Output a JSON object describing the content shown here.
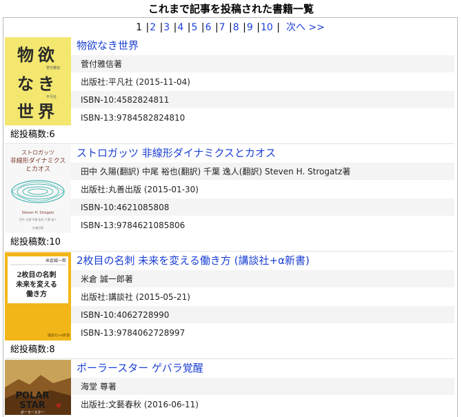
{
  "page": {
    "title": "これまで記事を投稿された書籍一覧"
  },
  "pagination": {
    "current": "1",
    "pages": [
      "2",
      "3",
      "4",
      "5",
      "6",
      "7",
      "8",
      "9",
      "10"
    ],
    "separator": "|",
    "next_label": "次へ >>"
  },
  "books": [
    {
      "title": "物欲なき世界",
      "author": "菅付雅信著",
      "publisher": "出版社:平凡社 (2015-11-04)",
      "isbn10": "ISBN-10:4582824811",
      "isbn13": "ISBN-13:9784582824810",
      "total": "総投稿数:6",
      "cover": {
        "lines": [
          "物 欲",
          "な き",
          "世 界"
        ],
        "bg": "#f3e770",
        "subtext": "菅付雅信",
        "publisher": "平凡社"
      }
    },
    {
      "title": "ストロガッツ 非線形ダイナミクスとカオス",
      "author": "田中 久陽(翻訳) 中尾 裕也(翻訳) 千葉 逸人(翻訳) Steven H. Strogatz著",
      "publisher": "出版社:丸善出版 (2015-01-30)",
      "isbn10": "ISBN-10:4621085808",
      "isbn13": "ISBN-13:9784621085806",
      "total": "総投稿数:10",
      "cover": {
        "lines": [
          "ストロガッツ",
          "非線形ダイナミクス",
          "とカオス"
        ],
        "bg": "#f7f7f7",
        "author": "Steven H. Strogatz"
      }
    },
    {
      "title": "2枚目の名刺 未来を変える働き方 (講談社+α新書)",
      "author": "米倉 誠一郎著",
      "publisher": "出版社:講談社 (2015-05-21)",
      "isbn10": "ISBN-10:4062728990",
      "isbn13": "ISBN-13:9784062728997",
      "total": "総投稿数:8",
      "cover": {
        "lines": [
          "2枚目の名刺",
          "未来を変える",
          "働き方"
        ],
        "bg": "#f2b619",
        "author": "米倉誠一郎"
      }
    },
    {
      "title": "ポーラースター ゲバラ覚醒",
      "author": "海堂 尊著",
      "publisher": "出版社:文藝春秋 (2016-06-11)",
      "isbn10": "",
      "isbn13": "",
      "total": "",
      "cover": {
        "lines": [
          "POLAR",
          "STAR"
        ],
        "bg": "#c9a25a",
        "subtext": "ポーラースター"
      }
    }
  ]
}
